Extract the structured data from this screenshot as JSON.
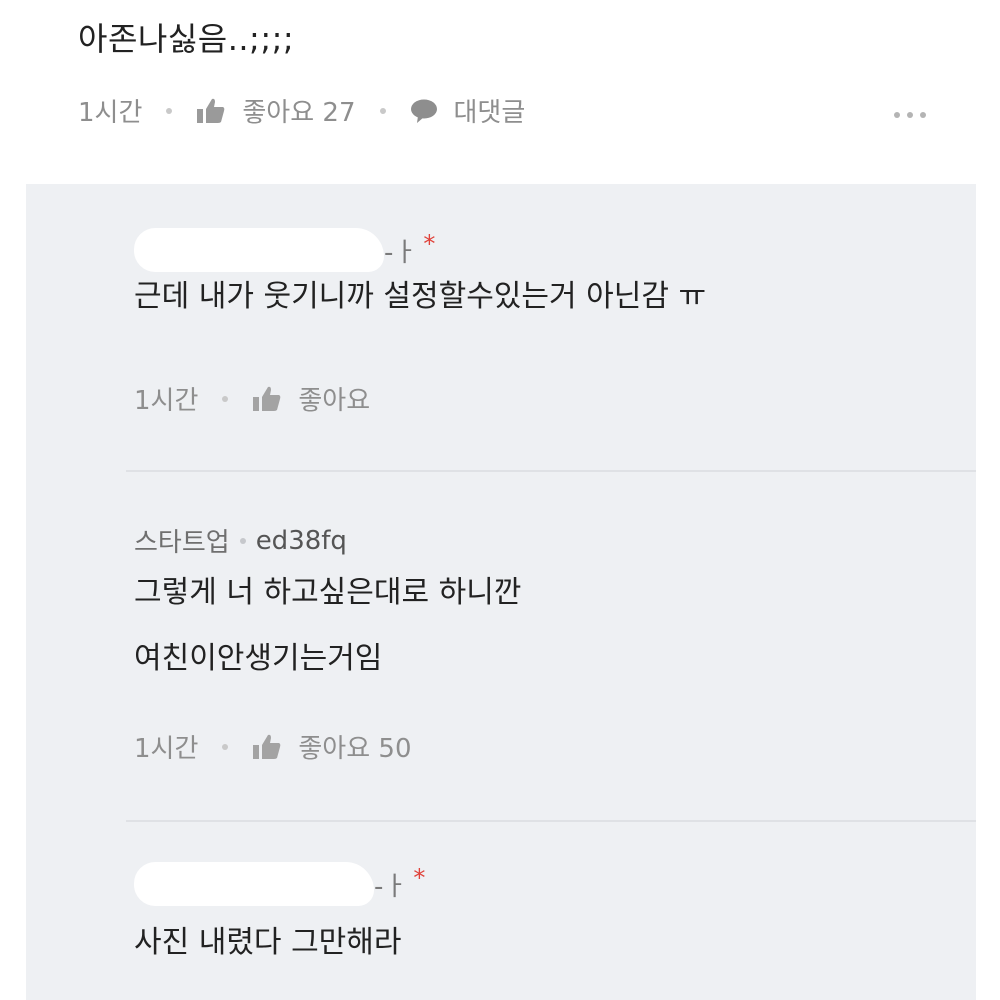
{
  "top_comment": {
    "text": "아존나싫음..;;;;",
    "time": "1시간",
    "like_label": "좋아요 27",
    "reply_label": "대댓글",
    "more_icon": "more-dots-icon"
  },
  "replies": [
    {
      "author_tail": "-ㅏ",
      "marker": "*",
      "text_lines": [
        "근데 내가 웃기니까 설정할수있는거 아닌감 ㅠ"
      ],
      "time": "1시간",
      "like_label": "좋아요"
    },
    {
      "author_name": "스타트업",
      "author_id": "ed38fq",
      "text_lines": [
        "그렇게 너 하고싶은대로 하니깐",
        "여친이안생기는거임"
      ],
      "time": "1시간",
      "like_label": "좋아요 50"
    },
    {
      "author_tail": "-ㅏ",
      "marker": "*",
      "text_lines": [
        "사진 내렸다 그만해라"
      ]
    }
  ],
  "colors": {
    "panel_bg": "#eef0f3",
    "meta_text": "#8e8e8e",
    "author_marker": "#e0423a"
  }
}
